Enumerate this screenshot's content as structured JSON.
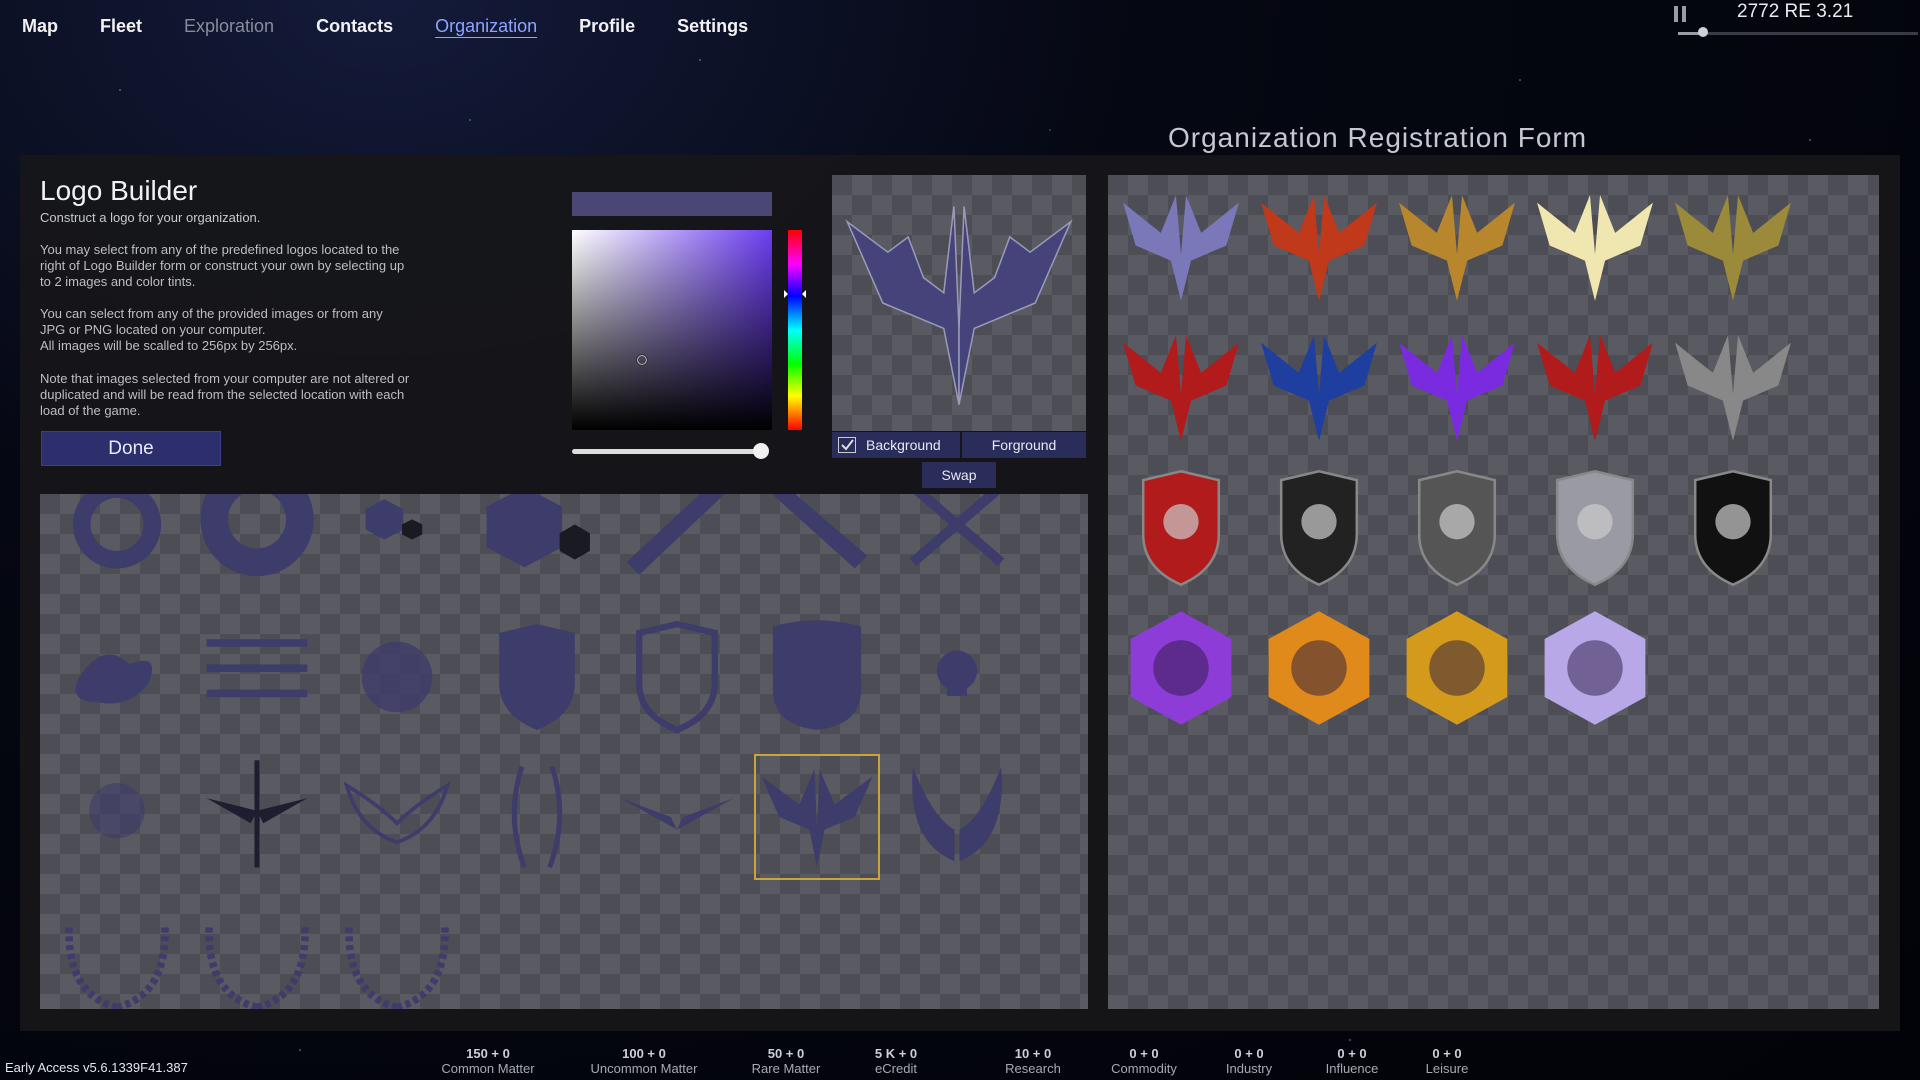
{
  "nav": {
    "items": [
      {
        "label": "Map",
        "state": "normal"
      },
      {
        "label": "Fleet",
        "state": "normal"
      },
      {
        "label": "Exploration",
        "state": "disabled"
      },
      {
        "label": "Contacts",
        "state": "normal"
      },
      {
        "label": "Organization",
        "state": "active"
      },
      {
        "label": "Profile",
        "state": "normal"
      },
      {
        "label": "Settings",
        "state": "normal"
      }
    ]
  },
  "clock": {
    "date": "2772 RE 3.21",
    "speed_fraction": 0.1
  },
  "registration_title": "Organization Registration Form",
  "builder": {
    "title": "Logo Builder",
    "subtitle": "Construct a logo for your organization.",
    "para1": "You may select from any of the predefined logos located to the right of Logo Builder form or construct your own by selecting up to 2 images and color tints.",
    "para2": "You can select from any of the provided images or from any JPG or PNG located on your computer.\nAll images will be scalled to 256px by 256px.",
    "para3": "Note that images selected from your computer are not altered or duplicated and will be read from the selected location with each load of the game.",
    "done_label": "Done"
  },
  "color_picker": {
    "current_color": "#4a4777",
    "hue_color": "#6b3df0",
    "saturation": 0.35,
    "value": 0.35,
    "alpha": 1.0
  },
  "layers": {
    "background_label": "Background",
    "foreground_label": "Forground",
    "swap_label": "Swap",
    "background_checked": true
  },
  "colors": {
    "accent": "#2c2f6b",
    "tint": "#3e3c6a",
    "selected_outline": "#c9a43a"
  },
  "parts": [
    {
      "icon": "ring-icon"
    },
    {
      "icon": "thick-ring-icon"
    },
    {
      "icon": "small-hexagons-icon"
    },
    {
      "icon": "large-hexagons-icon"
    },
    {
      "icon": "slash-icon"
    },
    {
      "icon": "backslash-icon"
    },
    {
      "icon": "crossed-swords-icon"
    },
    {
      "icon": "splatter-icon"
    },
    {
      "icon": "stripes-icon"
    },
    {
      "icon": "grunge-splatter-icon"
    },
    {
      "icon": "shield-icon"
    },
    {
      "icon": "shield-outline-icon"
    },
    {
      "icon": "badge-shield-icon"
    },
    {
      "icon": "small-skull-icon"
    },
    {
      "icon": "skull-faded-icon"
    },
    {
      "icon": "winged-sword-icon"
    },
    {
      "icon": "wings-outline-icon"
    },
    {
      "icon": "horns-icon"
    },
    {
      "icon": "flat-wings-icon"
    },
    {
      "icon": "phoenix-wings-icon",
      "selected": true
    },
    {
      "icon": "feathered-wings-icon"
    },
    {
      "icon": "laurel-wreath-icon"
    },
    {
      "icon": "laurel-wreath-icon"
    },
    {
      "icon": "laurel-wreath-icon"
    }
  ],
  "logos": [
    {
      "icon": "silver-phoenix-logo"
    },
    {
      "icon": "red-eagle-logo"
    },
    {
      "icon": "gold-ring-bird-logo"
    },
    {
      "icon": "white-phoenix-logo"
    },
    {
      "icon": "laurel-eagle-logo"
    },
    {
      "icon": "red-griffin-logo"
    },
    {
      "icon": "blue-crossed-blades-logo"
    },
    {
      "icon": "purple-splatter-logo"
    },
    {
      "icon": "red-winged-sword-logo"
    },
    {
      "icon": "blood-skull-logo"
    },
    {
      "icon": "skull-blood-slash-logo"
    },
    {
      "icon": "black-shield-skull-logo"
    },
    {
      "icon": "red-skull-shield-logo"
    },
    {
      "icon": "silver-winged-shield-logo"
    },
    {
      "icon": "white-dragon-shield-logo"
    },
    {
      "icon": "purple-vortex-logo"
    },
    {
      "icon": "orange-ring-emblem-logo"
    },
    {
      "icon": "gold-trident-hex-logo"
    },
    {
      "icon": "lavender-hex-cluster-logo"
    }
  ],
  "version": "Early Access v5.6.1339F41.387",
  "resources": [
    {
      "value": "150 + 0",
      "name": "Common Matter"
    },
    {
      "value": "100 + 0",
      "name": "Uncommon Matter"
    },
    {
      "value": "50 + 0",
      "name": "Rare Matter"
    },
    {
      "value": "5 K + 0",
      "name": "eCredit"
    },
    {
      "value": "10 + 0",
      "name": "Research"
    },
    {
      "value": "0 + 0",
      "name": "Commodity"
    },
    {
      "value": "0 + 0",
      "name": "Industry"
    },
    {
      "value": "0 + 0",
      "name": "Influence"
    },
    {
      "value": "0 + 0",
      "name": "Leisure"
    }
  ]
}
